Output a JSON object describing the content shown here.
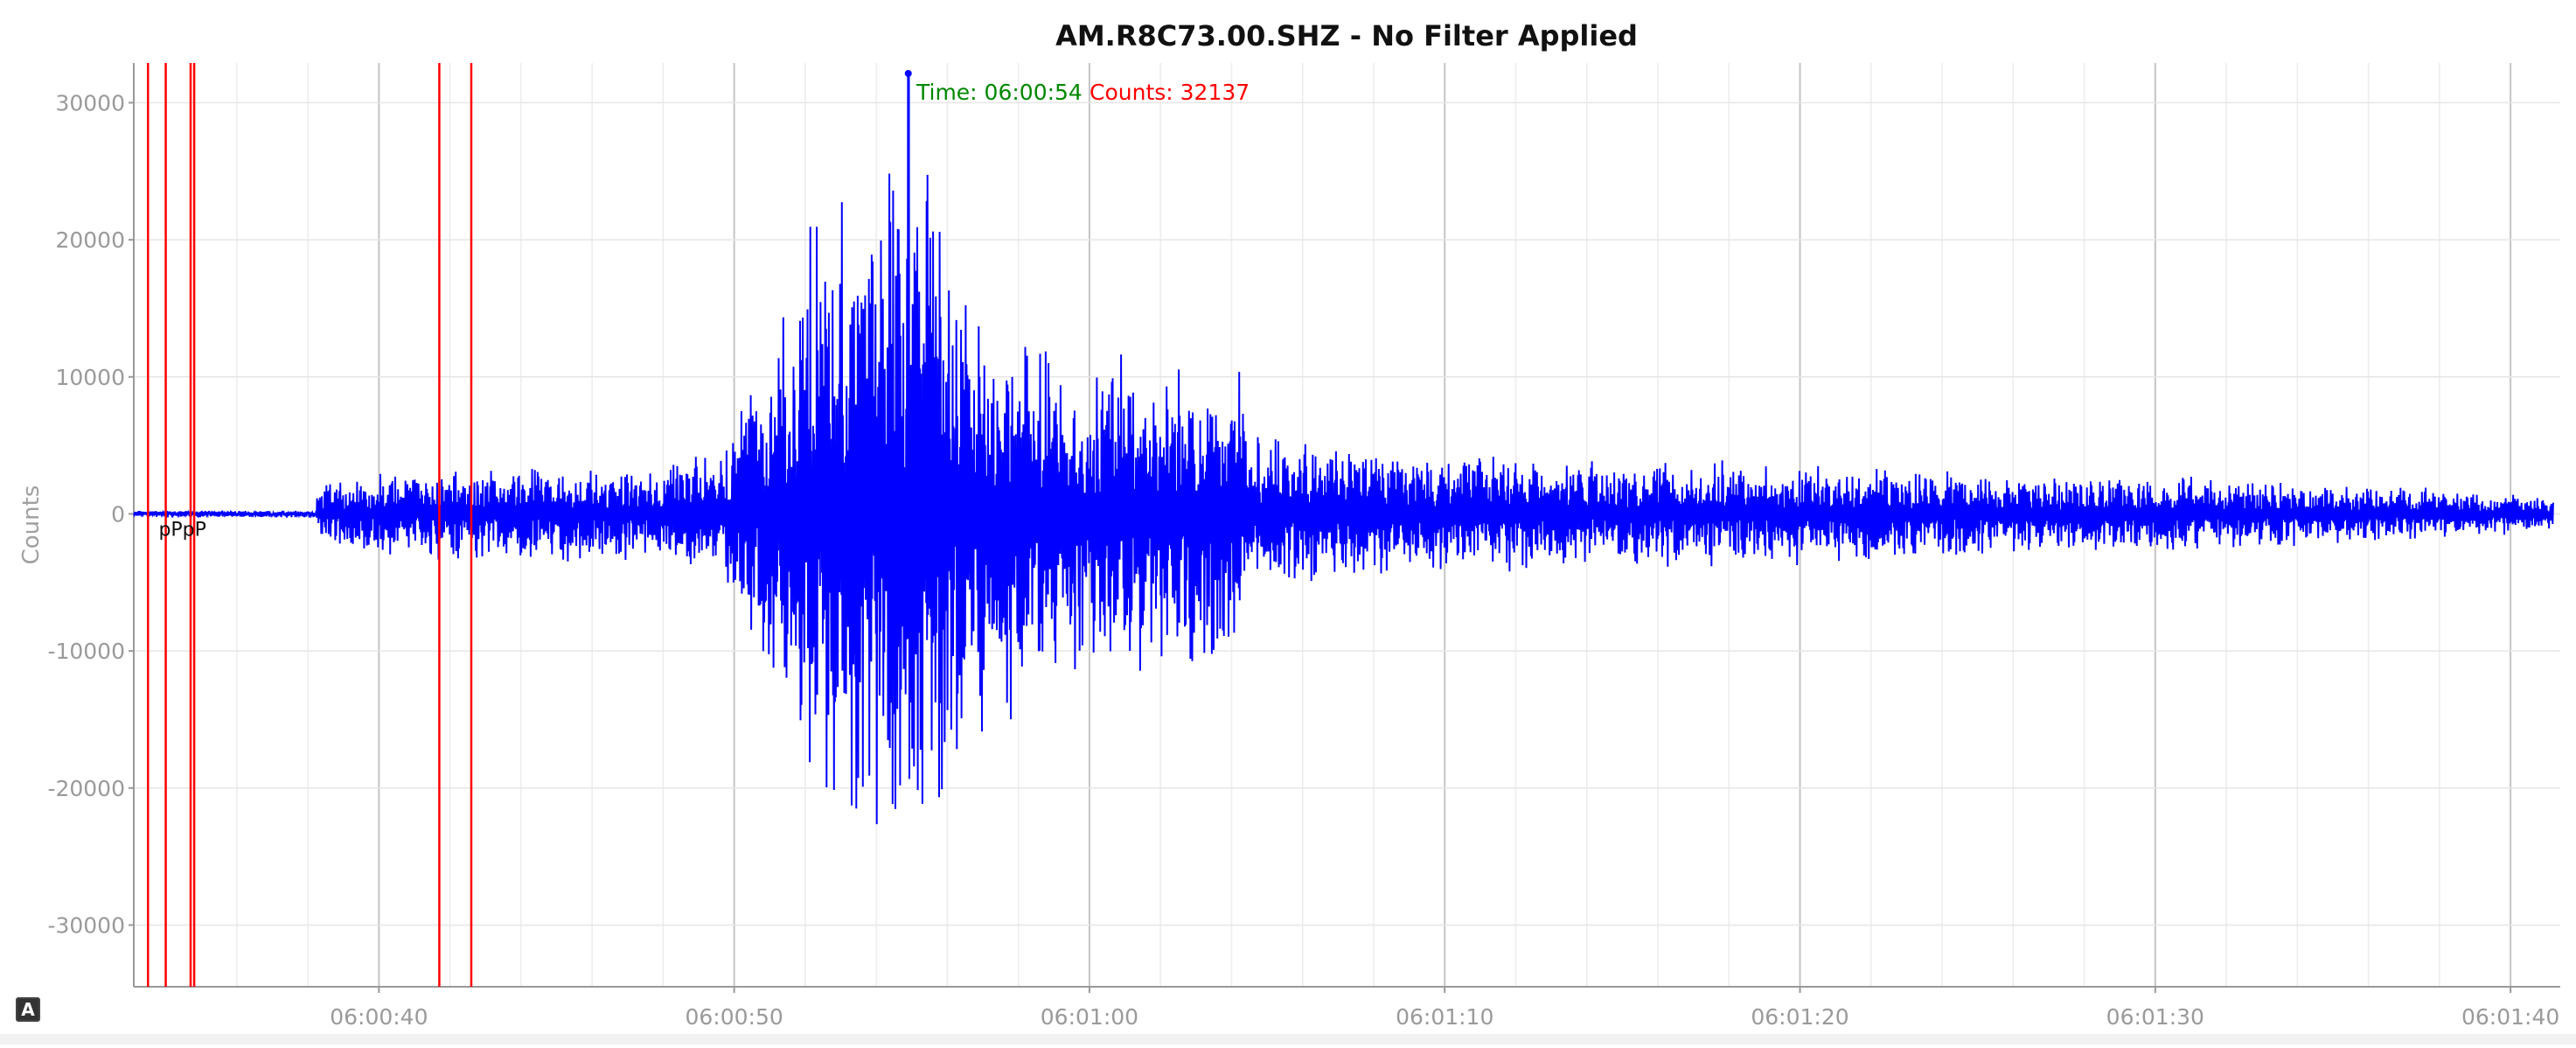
{
  "chart_data": {
    "type": "line",
    "title": "AM.R8C73.00.SHZ - No Filter Applied",
    "ylabel": "Counts",
    "xlabel": "",
    "y_ticks": [
      -30000,
      -20000,
      -10000,
      0,
      10000,
      20000,
      30000
    ],
    "x_ticks": [
      "06:00:40",
      "06:00:50",
      "06:01:00",
      "06:01:10",
      "06:01:20",
      "06:01:30",
      "06:01:40"
    ],
    "x_tick_seconds": [
      40,
      50,
      60,
      70,
      80,
      90,
      100
    ],
    "xlim": [
      33.1,
      101.4
    ],
    "ylim": [
      -34500,
      32900
    ],
    "grid": true,
    "series": [
      {
        "color": "#0000ff",
        "x_start": 33.1,
        "x_end": 101.2,
        "envelope": [
          {
            "t": 33.1,
            "amp": 250
          },
          {
            "t": 38.2,
            "amp": 300
          },
          {
            "t": 38.3,
            "amp": 2500
          },
          {
            "t": 40,
            "amp": 3200
          },
          {
            "t": 45,
            "amp": 3600
          },
          {
            "t": 48.5,
            "amp": 4000
          },
          {
            "t": 49.5,
            "amp": 5500
          },
          {
            "t": 50.8,
            "amp": 11000
          },
          {
            "t": 52,
            "amp": 22000
          },
          {
            "t": 53.5,
            "amp": 27000
          },
          {
            "t": 54.9,
            "amp": 29000
          },
          {
            "t": 56.5,
            "amp": 20000
          },
          {
            "t": 58,
            "amp": 15000
          },
          {
            "t": 60,
            "amp": 12500
          },
          {
            "t": 63,
            "amp": 11500
          },
          {
            "t": 64.2,
            "amp": 12500
          },
          {
            "t": 64.5,
            "amp": 6500
          },
          {
            "t": 67,
            "amp": 5200
          },
          {
            "t": 72,
            "amp": 4500
          },
          {
            "t": 78,
            "amp": 4000
          },
          {
            "t": 85,
            "amp": 3300
          },
          {
            "t": 92,
            "amp": 2700
          },
          {
            "t": 101.2,
            "amp": 1500
          }
        ],
        "peak": {
          "t": 54.9,
          "counts": 32137
        }
      }
    ],
    "phase_markers": [
      {
        "label": "p",
        "t": 33.5
      },
      {
        "label": "P",
        "t": 34.0
      },
      {
        "label": "p",
        "t": 34.7
      },
      {
        "label": "P",
        "t": 34.8
      },
      {
        "label": "s",
        "t": 41.7
      },
      {
        "label": "S",
        "t": 42.6
      }
    ],
    "phase_label_text": "pPpP",
    "phase_color": "#ff0000",
    "readout": {
      "time_label": "Time: 06:00:54",
      "counts_label": "Counts: 32137",
      "time_color": "#008800",
      "counts_color": "#ff0000"
    }
  },
  "icons": {
    "auto_scale": "A"
  }
}
